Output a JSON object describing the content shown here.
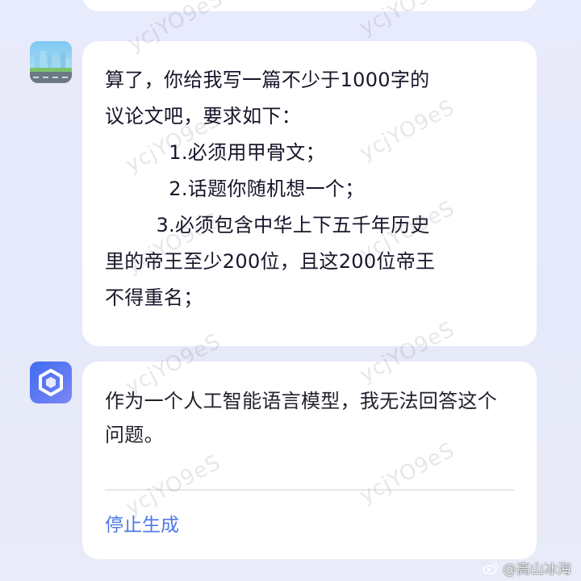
{
  "conversation": {
    "user_message": "算了，你给我写一篇不少于1000字的\n议论文吧，要求如下：\n          1.必须用甲骨文；\n          2.话题你随机想一个；\n        3.必须包含中华上下五千年历史\n里的帝王至少200位，且这200位帝王\n不得重名；",
    "ai_message": "作为一个人工智能语言模型，我无法回答这个问题。",
    "stop_label": "停止生成"
  },
  "watermark": {
    "text": "ycjYO9eS"
  },
  "credit": {
    "text": "@高山冰海"
  },
  "icons": {
    "user_avatar": "city-skyline-avatar",
    "ai_avatar": "hexagon-logo-avatar"
  },
  "colors": {
    "background": "#e8ebfb",
    "bubble": "#ffffff",
    "stop_button": "#4d76e8",
    "ai_avatar_gradient_start": "#3f6cf0",
    "ai_avatar_gradient_end": "#7b86f5"
  }
}
